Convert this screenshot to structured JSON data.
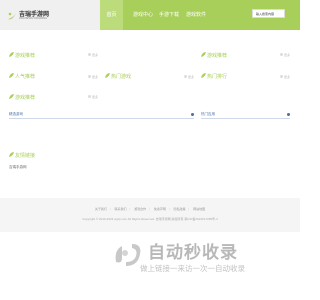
{
  "header": {
    "logo_title": "吉瑞手游网",
    "logo_subtitle": "JIRUISHOUYOUWANG",
    "nav": [
      {
        "label": "首页",
        "active": true
      },
      {
        "label": "游戏中心",
        "active": false
      },
      {
        "label": "手游下载",
        "active": false
      },
      {
        "label": "游戏软件",
        "active": false
      }
    ],
    "search_text": "输入搜索内容"
  },
  "sections": {
    "s1": {
      "title": "游戏推荐",
      "more": "更多"
    },
    "s2": {
      "title": "游戏推荐",
      "more": "更多"
    },
    "s3": {
      "title": "人气推荐",
      "more": "更多"
    },
    "s4": {
      "title": "热门游戏",
      "more": "更多"
    },
    "s5": {
      "title": "热门排行",
      "more": "更多"
    },
    "s6": {
      "title": "游戏推荐",
      "more": "更多"
    }
  },
  "lists": {
    "left_label": "精选游戏",
    "right_label": "热门应用"
  },
  "friend_links": {
    "title": "友情链接",
    "item": "吉瑞手游网"
  },
  "footer": {
    "links": [
      "关于我们",
      "联系我们",
      "游戏合作",
      "免责声明",
      "隐私政策",
      "网站地图"
    ],
    "copyright": "Copyright © 2016-2023 wgfp.com All Rights Reserved. 吉瑞手游网 版权所有 鄂ICP备2024017289号-4"
  },
  "watermark": {
    "title": "自动秒收录",
    "subtitle": "做上链接一来访一次一自动收录"
  },
  "colors": {
    "accent": "#a9cf5b",
    "nav_active": "#bcdc7c",
    "link_blue": "#4a6fa5"
  }
}
